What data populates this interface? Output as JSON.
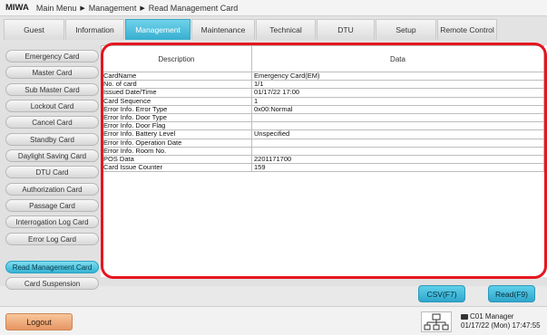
{
  "header": {
    "brand": "MIWA",
    "breadcrumb": [
      "Main Menu",
      "Management",
      "Read Management Card"
    ]
  },
  "tabs": [
    {
      "label": "Guest",
      "active": false
    },
    {
      "label": "Information",
      "active": false
    },
    {
      "label": "Management",
      "active": true
    },
    {
      "label": "Maintenance",
      "active": false
    },
    {
      "label": "Technical",
      "active": false
    },
    {
      "label": "DTU",
      "active": false
    },
    {
      "label": "Setup",
      "active": false
    },
    {
      "label": "Remote Control",
      "active": false
    }
  ],
  "sidebar": {
    "items": [
      {
        "label": "Emergency Card",
        "active": false
      },
      {
        "label": "Master Card",
        "active": false
      },
      {
        "label": "Sub Master Card",
        "active": false
      },
      {
        "label": "Lockout Card",
        "active": false
      },
      {
        "label": "Cancel Card",
        "active": false
      },
      {
        "label": "Standby Card",
        "active": false
      },
      {
        "label": "Daylight Saving Card",
        "active": false
      },
      {
        "label": "DTU Card",
        "active": false
      },
      {
        "label": "Authorization Card",
        "active": false
      },
      {
        "label": "Passage Card",
        "active": false
      },
      {
        "label": "Interrogation Log Card",
        "active": false
      },
      {
        "label": "Error Log Card",
        "active": false
      },
      {
        "label": "Read Management Card",
        "active": true
      },
      {
        "label": "Card Suspension",
        "active": false
      }
    ]
  },
  "table": {
    "headers": [
      "Description",
      "Data"
    ],
    "rows": [
      [
        "CardName",
        "Emergency Card(EM)"
      ],
      [
        "No. of card",
        "1/1"
      ],
      [
        "Issued Date/Time",
        "01/17/22 17:00"
      ],
      [
        "Card Sequence",
        "1"
      ],
      [
        "Error Info. Error Type",
        "0x00:Normal"
      ],
      [
        "Error Info. Door Type",
        ""
      ],
      [
        "Error Info. Door Flag",
        ""
      ],
      [
        "Error Info. Battery Level",
        "Unspecified"
      ],
      [
        "Error Info. Operation Date",
        ""
      ],
      [
        "Error Info. Room No.",
        ""
      ],
      [
        "POS Data",
        "2201171700"
      ],
      [
        "Card Issue Counter",
        "159"
      ]
    ]
  },
  "actions": {
    "csv_label": "CSV(F7)",
    "read_label": "Read(F9)"
  },
  "footer": {
    "logout_label": "Logout",
    "user_line": "C01 Manager",
    "datetime": "01/17/22 (Mon) 17:47:55"
  },
  "colors": {
    "accent": "#35b4d5",
    "highlight_border": "#e5161f",
    "logout": "#e79563"
  },
  "icons": {
    "network": "network-icon",
    "id_card": "id-card-icon"
  }
}
